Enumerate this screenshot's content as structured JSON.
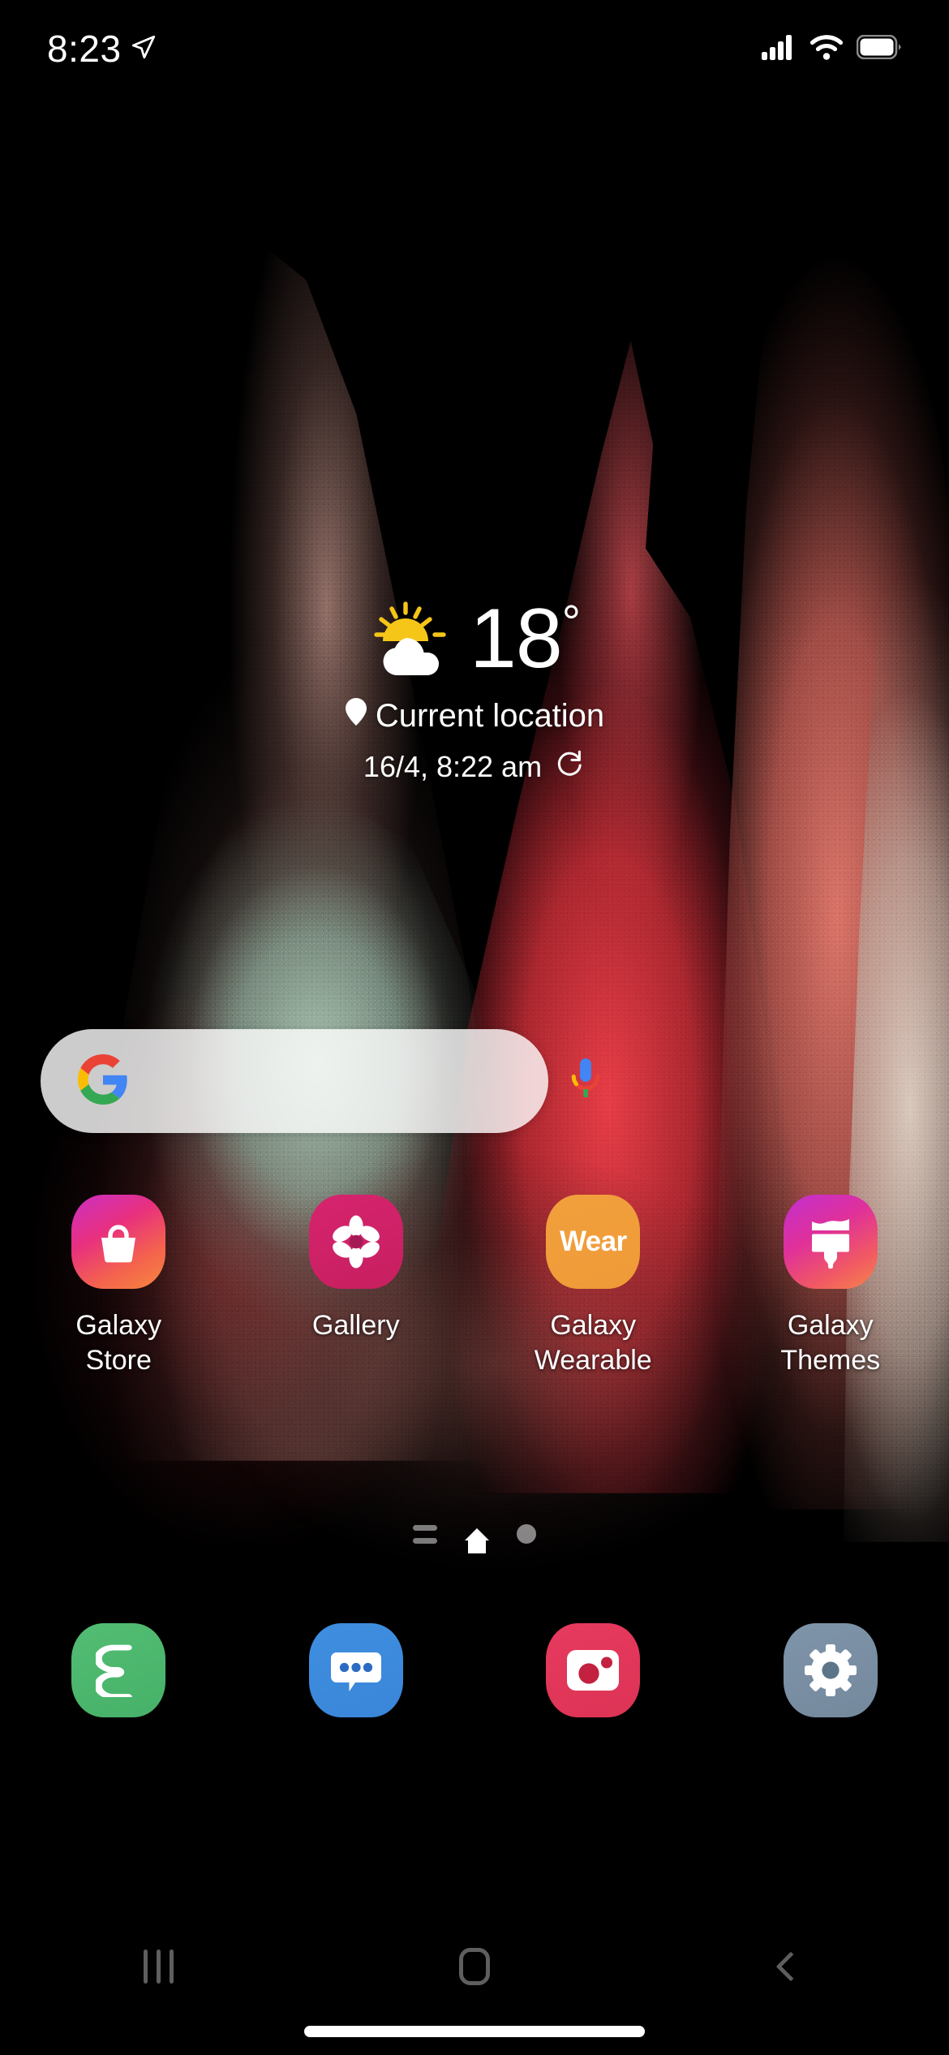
{
  "status_bar": {
    "time": "8:23",
    "location_arrow_icon": "location-arrow-icon",
    "signal_icon": "cellular-signal-icon",
    "signal_bars": 4,
    "wifi_icon": "wifi-icon",
    "battery_icon": "battery-full-icon",
    "battery_level": 100
  },
  "weather": {
    "condition_icon": "partly-cloudy-icon",
    "temperature": "18",
    "degree_symbol": "°",
    "location_pin_icon": "location-pin-icon",
    "location": "Current location",
    "updated": "16/4, 8:22 am",
    "refresh_icon": "refresh-icon"
  },
  "search": {
    "google_logo_icon": "google-g-icon",
    "mic_icon": "google-mic-icon",
    "value": "",
    "placeholder": ""
  },
  "apps": [
    {
      "label": "Galaxy\nStore",
      "icon": "shopping-bag-icon",
      "icon_class": "ic-store",
      "name": "galaxy-store"
    },
    {
      "label": "Gallery",
      "icon": "flower-icon",
      "icon_class": "ic-gallery",
      "name": "gallery"
    },
    {
      "label": "Galaxy\nWearable",
      "icon": "wear-text-icon",
      "icon_class": "ic-wear",
      "name": "galaxy-wearable",
      "icon_text": "Wear"
    },
    {
      "label": "Galaxy\nThemes",
      "icon": "paint-brush-icon",
      "icon_class": "ic-themes",
      "name": "galaxy-themes"
    }
  ],
  "page_indicator": {
    "feed_icon": "feed-page-icon",
    "home_icon": "home-page-icon",
    "dot_icon": "page-dot-icon",
    "pages": 3,
    "active": 1
  },
  "dock": [
    {
      "icon": "phone-icon",
      "icon_class": "ic-phone",
      "name": "phone"
    },
    {
      "icon": "messages-icon",
      "icon_class": "ic-messages",
      "name": "messages"
    },
    {
      "icon": "camera-icon",
      "icon_class": "ic-camera",
      "name": "camera"
    },
    {
      "icon": "settings-gear-icon",
      "icon_class": "ic-settings",
      "name": "settings"
    }
  ],
  "nav_bar": {
    "recents_icon": "recents-icon",
    "home_icon": "home-button-icon",
    "back_icon": "back-chevron-icon"
  },
  "home_indicator": {
    "icon": "home-indicator-bar"
  },
  "colors": {
    "google_blue": "#4285F4",
    "google_red": "#EA4335",
    "google_yellow": "#FBBC05",
    "google_green": "#34A853",
    "weather_sun": "#F5C518",
    "nav_tint": "#5E5E5E"
  }
}
